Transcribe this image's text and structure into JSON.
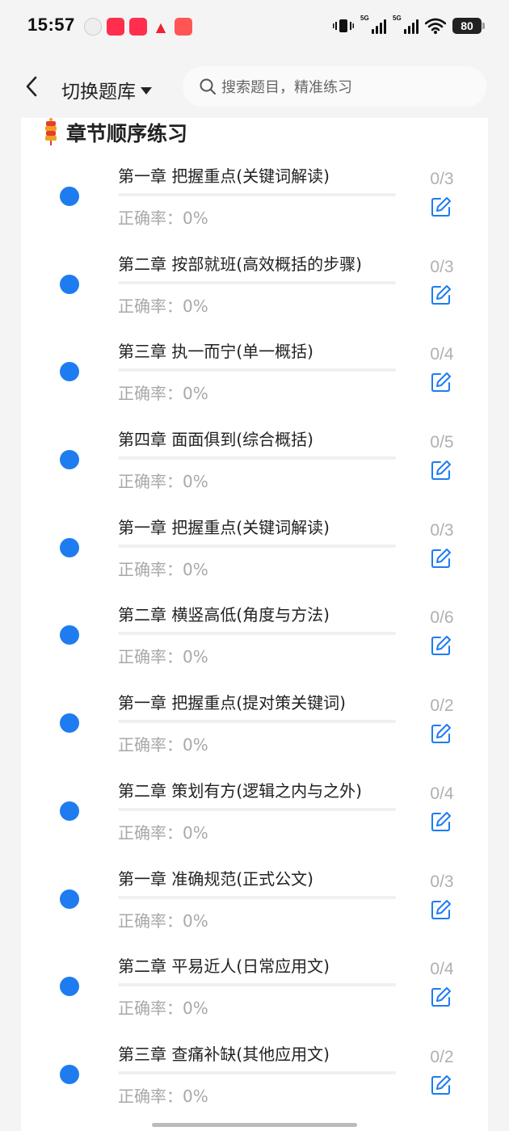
{
  "status_bar": {
    "time": "15:57",
    "notification_icons": [
      "avatar-icon",
      "xiaohongshu-icon",
      "xiaohongshu-icon",
      "warning-icon",
      "app-icon"
    ],
    "network": [
      "5G",
      "5G"
    ],
    "battery": "80"
  },
  "header": {
    "title": "切换题库",
    "search_placeholder": "搜索题目，精准练习"
  },
  "section": {
    "title": "章节顺序练习"
  },
  "chapters": [
    {
      "name": "第一章 把握重点(关键词解读)",
      "accuracy": "正确率：0%",
      "count": "0/3",
      "progress": 0
    },
    {
      "name": "第二章 按部就班(高效概括的步骤)",
      "accuracy": "正确率：0%",
      "count": "0/3",
      "progress": 0
    },
    {
      "name": "第三章 执一而宁(单一概括)",
      "accuracy": "正确率：0%",
      "count": "0/4",
      "progress": 0
    },
    {
      "name": "第四章 面面俱到(综合概括)",
      "accuracy": "正确率：0%",
      "count": "0/5",
      "progress": 0
    },
    {
      "name": "第一章 把握重点(关键词解读)",
      "accuracy": "正确率：0%",
      "count": "0/3",
      "progress": 0
    },
    {
      "name": "第二章 横竖高低(角度与方法)",
      "accuracy": "正确率：0%",
      "count": "0/6",
      "progress": 0
    },
    {
      "name": "第一章 把握重点(提对策关键词)",
      "accuracy": "正确率：0%",
      "count": "0/2",
      "progress": 0
    },
    {
      "name": "第二章 策划有方(逻辑之内与之外)",
      "accuracy": "正确率：0%",
      "count": "0/4",
      "progress": 0
    },
    {
      "name": "第一章 准确规范(正式公文)",
      "accuracy": "正确率：0%",
      "count": "0/3",
      "progress": 0
    },
    {
      "name": "第二章 平易近人(日常应用文)",
      "accuracy": "正确率：0%",
      "count": "0/4",
      "progress": 0
    },
    {
      "name": "第三章 查痛补缺(其他应用文)",
      "accuracy": "正确率：0%",
      "count": "0/2",
      "progress": 0
    }
  ],
  "colors": {
    "accent": "#1e7cf0",
    "muted_text": "#a8a8a8",
    "background": "#f4f4f4"
  }
}
